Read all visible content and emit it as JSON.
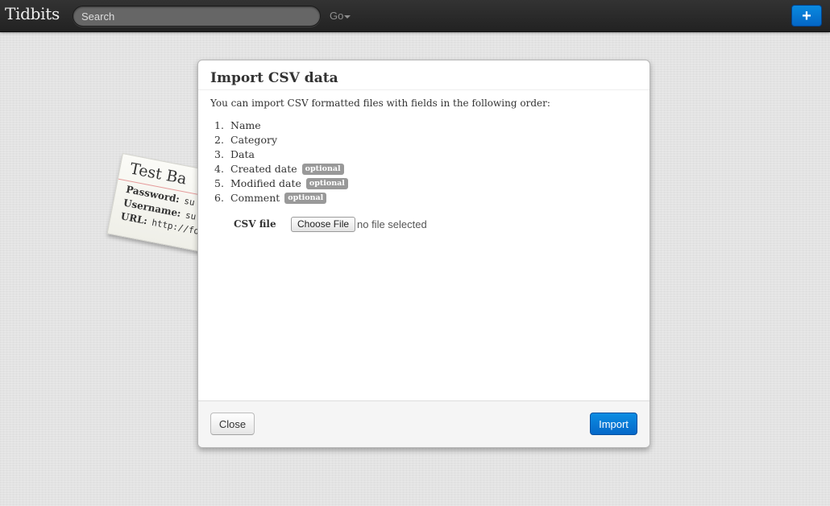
{
  "navbar": {
    "brand": "Tidbits",
    "search_placeholder": "Search",
    "go_label": "Go",
    "add_label": "+"
  },
  "background_card": {
    "title": "Test Ba",
    "rows": [
      {
        "label": "Password:",
        "value": "su"
      },
      {
        "label": "Username:",
        "value": "su"
      },
      {
        "label": "URL:",
        "value": "http://fo"
      }
    ]
  },
  "modal": {
    "title": "Import CSV data",
    "intro": "You can import CSV formatted files with fields in the following order:",
    "fields": [
      {
        "number": "1.",
        "name": "Name",
        "badge": ""
      },
      {
        "number": "2.",
        "name": "Category",
        "badge": ""
      },
      {
        "number": "3.",
        "name": "Data",
        "badge": ""
      },
      {
        "number": "4.",
        "name": "Created date",
        "badge": "optional"
      },
      {
        "number": "5.",
        "name": "Modified date",
        "badge": "optional"
      },
      {
        "number": "6.",
        "name": "Comment",
        "badge": "optional"
      }
    ],
    "csv_label": "CSV file",
    "choose_file_label": "Choose File",
    "file_status": "no file selected",
    "close_label": "Close",
    "import_label": "Import"
  },
  "colors": {
    "navbar_bg": "#2b2b2b",
    "primary": "#0575d6",
    "badge": "#999999",
    "page_bg": "#e3e3e3"
  }
}
